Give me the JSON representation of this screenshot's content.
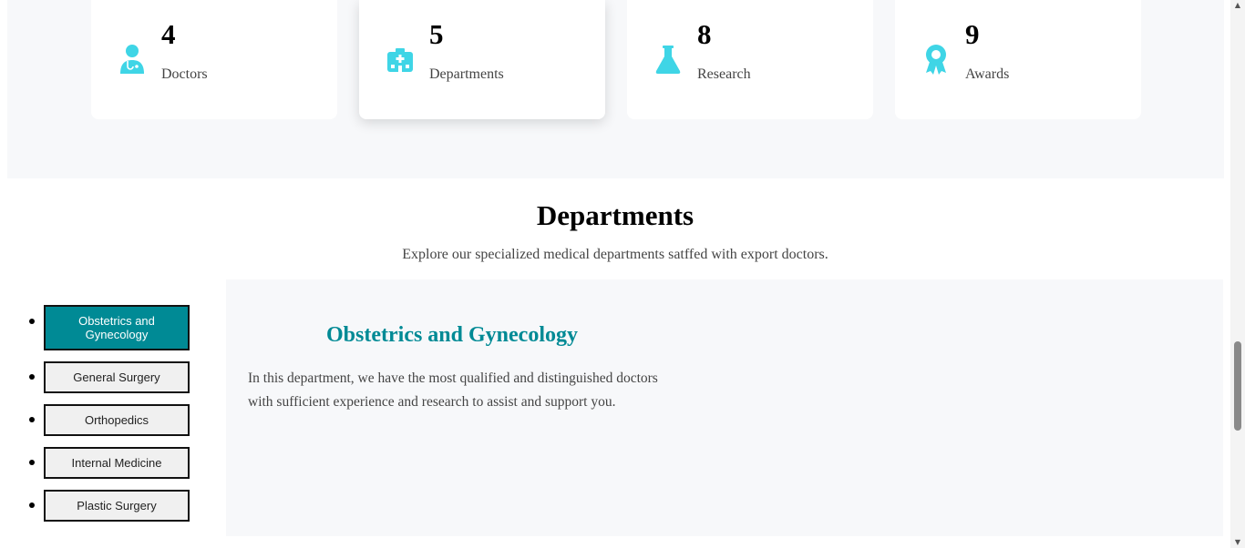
{
  "stats": [
    {
      "number": "4",
      "label": "Doctors",
      "icon": "doctor-icon"
    },
    {
      "number": "5",
      "label": "Departments",
      "icon": "hospital-icon"
    },
    {
      "number": "8",
      "label": "Research",
      "icon": "flask-icon"
    },
    {
      "number": "9",
      "label": "Awards",
      "icon": "award-icon"
    }
  ],
  "departments": {
    "title": "Departments",
    "subtitle": "Explore our specialized medical departments satffed with export doctors.",
    "tabs": [
      {
        "label": "Obstetrics and Gynecology",
        "active": true
      },
      {
        "label": "General Surgery",
        "active": false
      },
      {
        "label": "Orthopedics",
        "active": false
      },
      {
        "label": "Internal Medicine",
        "active": false
      },
      {
        "label": "Plastic Surgery",
        "active": false
      }
    ],
    "content": {
      "heading": "Obstetrics and Gynecology",
      "text": "In this department, we have the most qualified and distinguished doctors with sufficient experience and research to assist and support you."
    }
  },
  "colors": {
    "accent": "#008a95",
    "icon": "#3fd5e6",
    "band_background": "#f7f8fa"
  }
}
